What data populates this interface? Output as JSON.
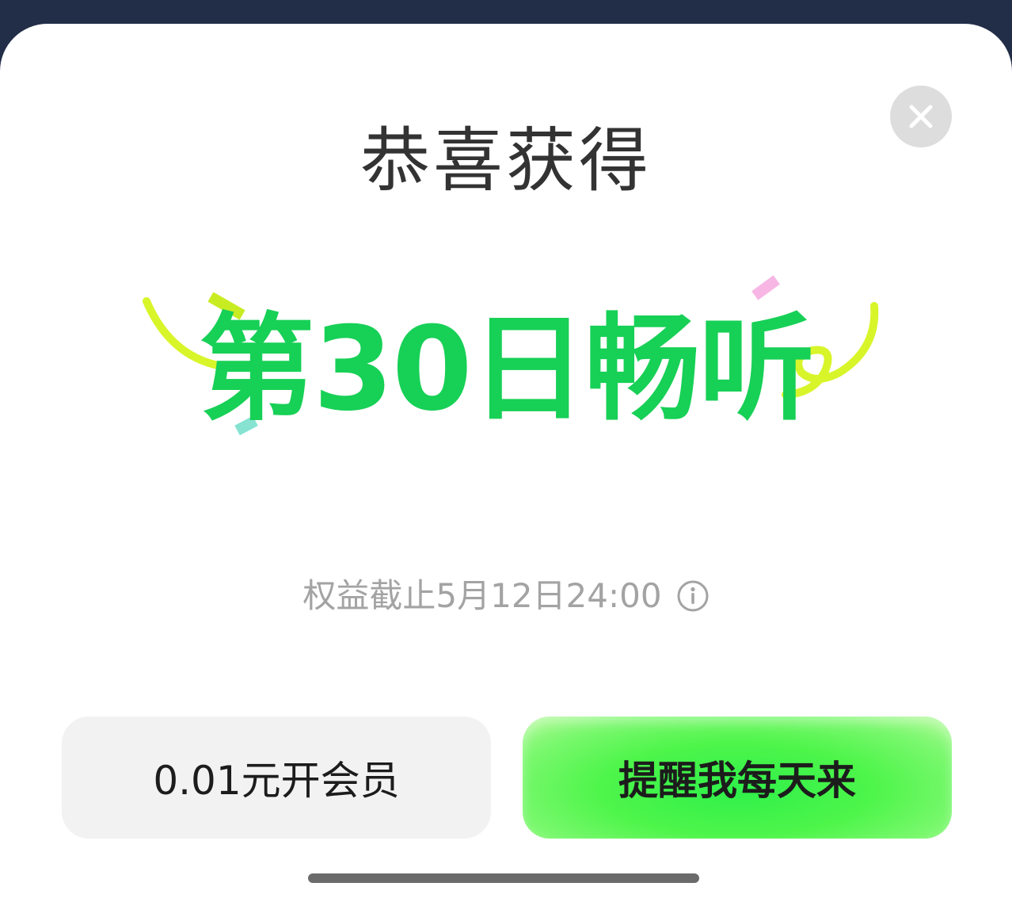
{
  "dialog": {
    "title": "恭喜获得",
    "reward_title": "第30日畅听",
    "expiry_text": "权益截止5月12日24:00",
    "close_icon": "close-icon",
    "info_icon": "info-icon"
  },
  "buttons": {
    "member_label": "0.01元开会员",
    "remind_label": "提醒我每天来"
  },
  "colors": {
    "accent_green": "#17d056",
    "button_green": "#4ef54a",
    "ribbon_lime": "#d8f52a",
    "confetti_pink": "#f7b6e4",
    "confetti_teal": "#86e3d2",
    "overlay_dark": "#222e48"
  }
}
